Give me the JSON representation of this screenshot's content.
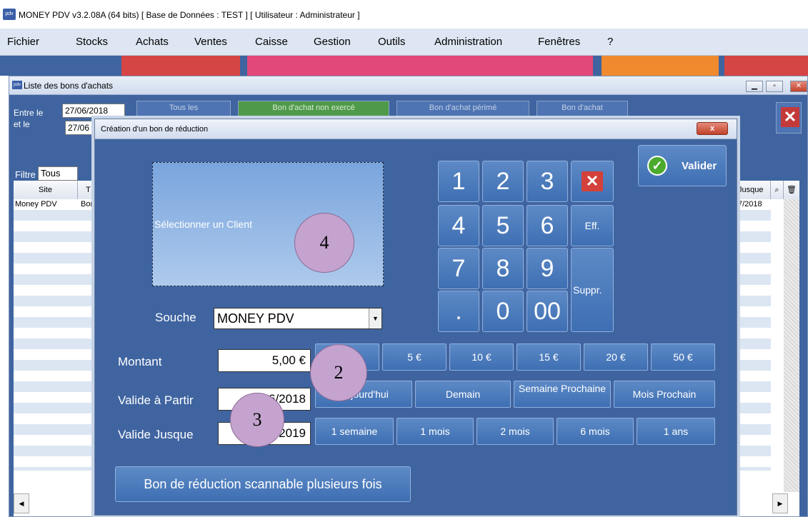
{
  "window": {
    "title": "MONEY PDV v3.2.08A (64 bits) [ Base de Données : TEST ] [ Utilisateur : Administrateur ]",
    "icon_label": "pdv"
  },
  "menu": [
    "Fichier",
    "Stocks",
    "Achats",
    "Ventes",
    "Caisse",
    "Gestion",
    "Outils",
    "Administration",
    "Fenêtres",
    "?"
  ],
  "list_window": {
    "title": "Liste des bons d'achats",
    "entre_le_label": "Entre le",
    "et_le_label": "et le",
    "date_from": "27/06/2018",
    "date_to": "27/06",
    "top_buttons": [
      {
        "label": "Tous les",
        "active": false
      },
      {
        "label": "Bon d'achat non exercé",
        "active": true
      },
      {
        "label": "Bon d'achat périmé",
        "active": false
      },
      {
        "label": "Bon d'achat",
        "active": false
      }
    ],
    "filter_label": "Filtre",
    "filter_value": "Tous",
    "grid": {
      "col_site": "Site",
      "col_t": "T",
      "col_jusque": "Jusque",
      "row_site": "Money PDV",
      "row_type": "Bon",
      "row_jusque": "7/2018"
    }
  },
  "dialog": {
    "title": "Création d'un bon de réduction",
    "close_label": "x",
    "client_placeholder": "Sélectionner un Client",
    "souche_label": "Souche",
    "souche_value": "MONEY PDV",
    "keypad": {
      "k1": "1",
      "k2": "2",
      "k3": "3",
      "k4": "4",
      "k5": "5",
      "k6": "6",
      "k7": "7",
      "k8": "8",
      "k9": "9",
      "dot": ".",
      "k0": "0",
      "k00": "00",
      "eff": "Eff.",
      "suppr": "Suppr."
    },
    "valider_label": "Valider",
    "montant_label": "Montant",
    "montant_value": "5,00 €",
    "valide_a_partir_label": "Valide à Partir",
    "valide_a_partir_value": "27/06/2018",
    "valide_jusque_label": "Valide Jusque",
    "valide_jusque_value": "27/06/2019",
    "amount_buttons": [
      "5 €",
      "10 €",
      "15 €",
      "20 €",
      "50 €"
    ],
    "start_buttons": [
      "Aujourd'hui",
      "Demain",
      "Semaine Prochaine",
      "Mois Prochain"
    ],
    "end_buttons": [
      "1 semaine",
      "1 mois",
      "2 mois",
      "6 mois",
      "1 ans"
    ],
    "multi_scan_label": "Bon de réduction scannable plusieurs fois"
  },
  "annotations": {
    "badge_2": "2",
    "badge_3": "3",
    "badge_4": "4"
  },
  "colors": {
    "panel_blue": "#3f64a0",
    "button_blue": "#4e80c2",
    "badge": "#c4a3cf",
    "close_red": "#d4403a",
    "valider_green": "#4caa2e"
  }
}
